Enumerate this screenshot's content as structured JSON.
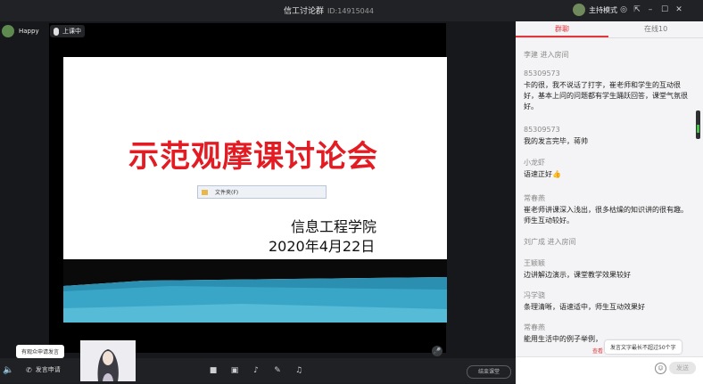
{
  "topbar": {
    "room_name": "信工讨论群",
    "room_id": "ID:14915044",
    "host_mode_label": "主持模式",
    "icons": [
      "target-icon",
      "external-icon",
      "minimize-icon",
      "maximize-icon",
      "close-icon"
    ]
  },
  "video": {
    "user_name": "Happy",
    "live_label": "上课中"
  },
  "slide": {
    "title": "示范观摩课讨论会",
    "folder_label": "文件夹(F)",
    "school": "信息工程学院",
    "date": "2020年4月22日"
  },
  "bottom": {
    "tooltip": "有观众申请发言",
    "apply_label": "发言申请",
    "end_label": "结束课堂"
  },
  "tabs": {
    "chat": "群聊",
    "online": "在线10"
  },
  "chat": [
    {
      "type": "system",
      "text": "李建 进入房间"
    },
    {
      "type": "msg",
      "user": "85309573",
      "text": "卡的很，我不说话了打字，崔老师和学生的互动很好，基本上问的问题都有学生踊跃回答，课堂气氛很好。"
    },
    {
      "type": "msg",
      "user": "85309573",
      "text": "我的发言完毕，蒋帅"
    },
    {
      "type": "msg",
      "user": "小龙虾",
      "text": "语速正好👍"
    },
    {
      "type": "msg",
      "user": "常春燕",
      "text": "崔老师讲课深入浅出，很多枯燥的知识讲的很有趣。师生互动较好。"
    },
    {
      "type": "system",
      "text": "刘广成 进入房间"
    },
    {
      "type": "msg",
      "user": "王颖颖",
      "text": "边讲解边演示，课堂教学效果较好"
    },
    {
      "type": "msg",
      "user": "冯学骁",
      "text": "条理清晰，语速适中，师生互动效果好"
    },
    {
      "type": "msg",
      "user": "常春燕",
      "text": "能用生活中的例子举例，"
    }
  ],
  "input": {
    "tooltip": "发言文字最长不超过50个字",
    "see_label": "查看",
    "send_label": "发送"
  },
  "colors": {
    "accent": "#e0383e",
    "slide_title": "#e31c24"
  }
}
